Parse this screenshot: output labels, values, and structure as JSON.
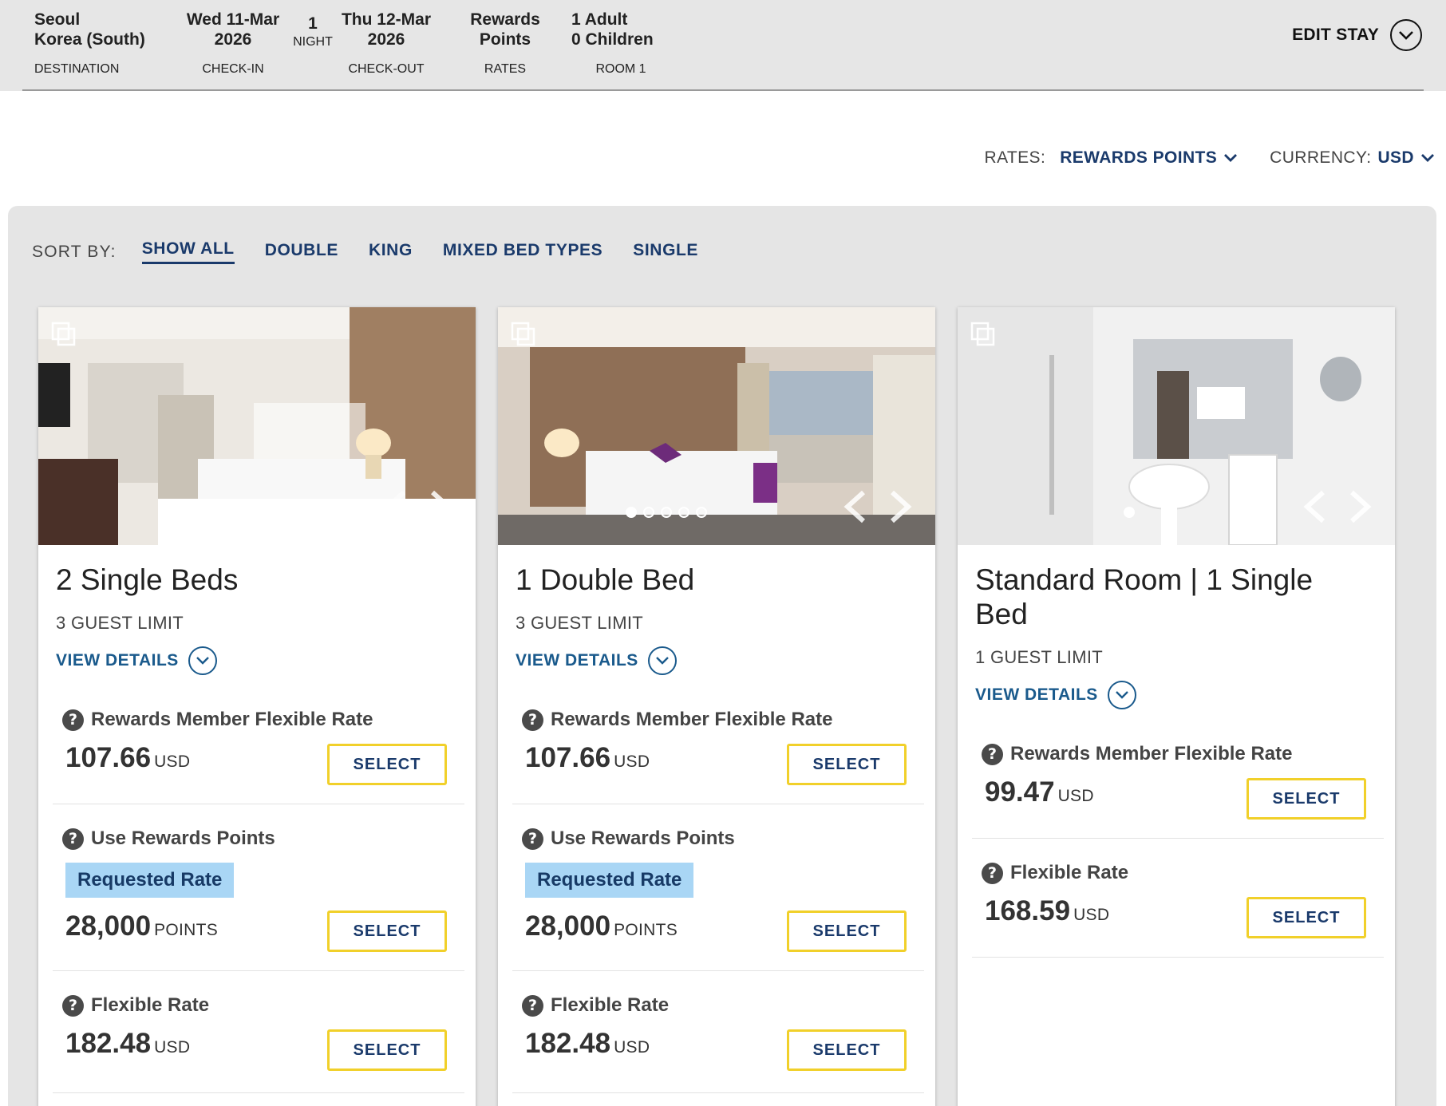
{
  "stay": {
    "destination": "Seoul\nKorea (South)",
    "destination_label": "DESTINATION",
    "checkin": "Wed 11-Mar\n2026",
    "checkin_label": "CHECK-IN",
    "nights": "1",
    "nights_label": "NIGHT",
    "checkout": "Thu 12-Mar\n2026",
    "checkout_label": "CHECK-OUT",
    "rates": "Rewards\nPoints",
    "rates_label": "RATES",
    "room": "1  Adult\n0  Children",
    "room_label": "ROOM 1",
    "edit_label": "EDIT STAY"
  },
  "filters": {
    "rates_label": "RATES:",
    "rates_value": "REWARDS POINTS",
    "currency_label": "CURRENCY:",
    "currency_value": "USD"
  },
  "sort": {
    "label": "SORT BY:",
    "options": [
      "SHOW ALL",
      "DOUBLE",
      "KING",
      "MIXED BED TYPES",
      "SINGLE"
    ],
    "active": "SHOW ALL"
  },
  "rooms": [
    {
      "title": "2 Single Beds",
      "guest_limit": "3 GUEST LIMIT",
      "details_label": "VIEW DETAILS",
      "rates": [
        {
          "name": "Rewards Member Flexible Rate",
          "price": "107.66",
          "unit": "USD",
          "button": "SELECT"
        },
        {
          "name": "Use Rewards Points",
          "badge": "Requested Rate",
          "price": "28,000",
          "unit": "POINTS",
          "button": "SELECT"
        },
        {
          "name": "Flexible Rate",
          "price": "182.48",
          "unit": "USD",
          "button": "SELECT"
        }
      ]
    },
    {
      "title": "1 Double Bed",
      "guest_limit": "3 GUEST LIMIT",
      "details_label": "VIEW DETAILS",
      "rates": [
        {
          "name": "Rewards Member Flexible Rate",
          "price": "107.66",
          "unit": "USD",
          "button": "SELECT"
        },
        {
          "name": "Use Rewards Points",
          "badge": "Requested Rate",
          "price": "28,000",
          "unit": "POINTS",
          "button": "SELECT"
        },
        {
          "name": "Flexible Rate",
          "price": "182.48",
          "unit": "USD",
          "button": "SELECT"
        }
      ]
    },
    {
      "title": "Standard Room | 1 Single Bed",
      "guest_limit": "1 GUEST LIMIT",
      "details_label": "VIEW DETAILS",
      "rates": [
        {
          "name": "Rewards Member Flexible Rate",
          "price": "99.47",
          "unit": "USD",
          "button": "SELECT"
        },
        {
          "name": "Flexible Rate",
          "price": "168.59",
          "unit": "USD",
          "button": "SELECT"
        }
      ]
    }
  ],
  "colors": {
    "accent": "#1a3a6b",
    "link": "#1a5a8c",
    "button_border": "#f1d02a",
    "badge": "#a9d6f5"
  }
}
